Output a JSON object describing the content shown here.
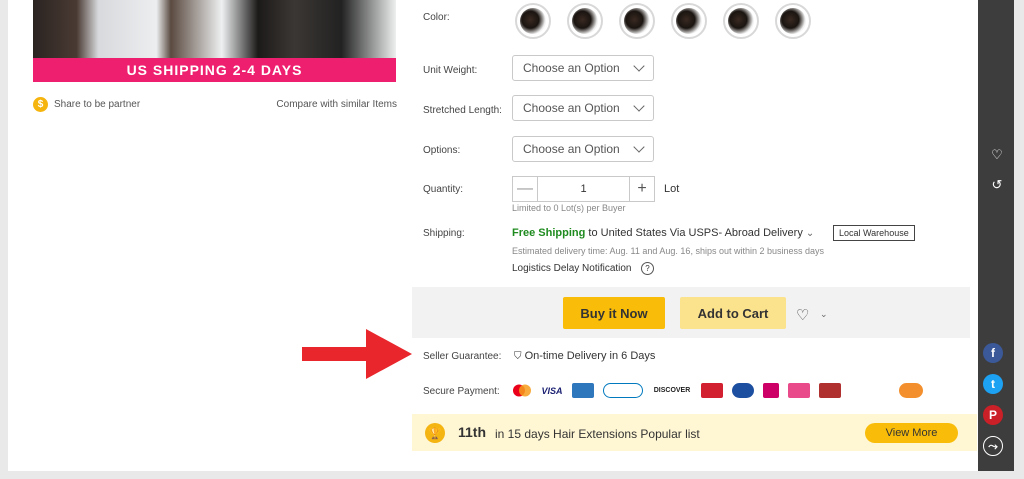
{
  "banner": {
    "text": "US SHIPPING  2-4 DAYS"
  },
  "share": {
    "coin_glyph": "$",
    "share_label": "Share to be partner",
    "compare_label": "Compare with similar Items"
  },
  "form": {
    "color_label": "Color:",
    "unit_weight_label": "Unit Weight:",
    "unit_weight_value": "Choose an Option",
    "stretched_length_label": "Stretched Length:",
    "stretched_length_value": "Choose an Option",
    "options_label": "Options:",
    "options_value": "Choose an Option",
    "quantity_label": "Quantity:",
    "quantity_value": "1",
    "quantity_unit": "Lot",
    "quantity_limit": "Limited to 0 Lot(s) per Buyer",
    "shipping_label": "Shipping:",
    "free_shipping": "Free Shipping",
    "shipping_to": "to",
    "shipping_dest": "United States Via USPS- Abroad Delivery",
    "local_warehouse": "Local Warehouse",
    "delivery_estimate": "Estimated delivery time: Aug. 11 and Aug. 16, ships out within 2 business days",
    "logistics_notice": "Logistics Delay Notification",
    "help_glyph": "?"
  },
  "actions": {
    "buy_now": "Buy it Now",
    "add_to_cart": "Add to Cart",
    "wishlist_glyph": "♡",
    "wishlist_dropdown": "⌄"
  },
  "guarantee": {
    "label": "Seller Guarantee:",
    "value": "On-time Delivery in 6 Days"
  },
  "payment": {
    "label": "Secure Payment:",
    "methods": [
      "VISA",
      "DISCOVER"
    ]
  },
  "ranking": {
    "trophy_glyph": "🏆",
    "rank": "11th",
    "text": "in 15 days Hair Extensions Popular list",
    "view_more": "View More"
  },
  "sidebar": {
    "heart_glyph": "♡",
    "history_glyph": "↺",
    "facebook_glyph": "f",
    "twitter_glyph": "t",
    "pinterest_glyph": "P",
    "share_glyph": "⤳"
  },
  "colors": {
    "brand_pink": "#ef1f6f",
    "buy_yellow": "#f9bd09",
    "cart_yellow": "#fbe28c",
    "free_ship_green": "#1f8b1f",
    "arrow_red": "#e8262b",
    "sidebar_dark": "#3d3d3d"
  }
}
